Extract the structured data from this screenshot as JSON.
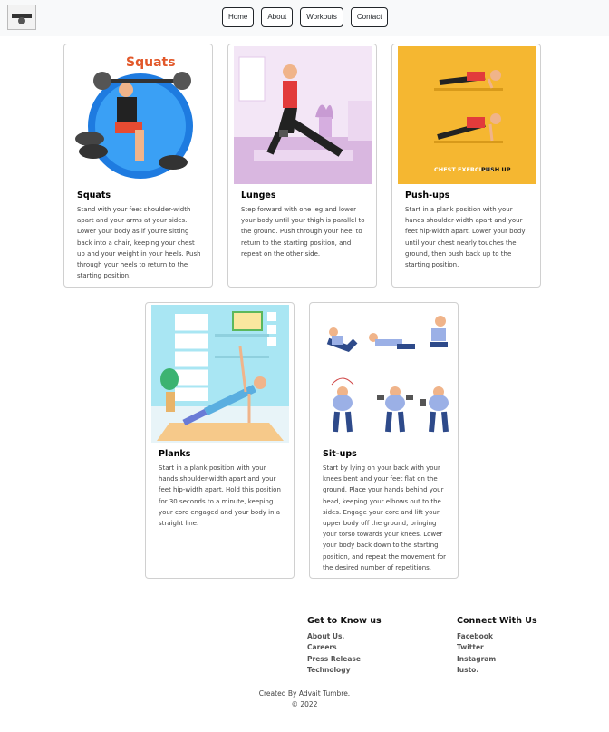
{
  "nav": {
    "logo_alt": "site logo",
    "items": [
      {
        "label": "Home"
      },
      {
        "label": "About"
      },
      {
        "label": "Workouts"
      },
      {
        "label": "Contact"
      }
    ]
  },
  "cards": [
    {
      "title": "Squats",
      "image_caption": "Squats",
      "description": "Stand with your feet shoulder-width apart and your arms at your sides. Lower your body as if you're sitting back into a chair, keeping your chest up and your weight in your heels. Push through your heels to return to the starting position."
    },
    {
      "title": "Lunges",
      "description": "Step forward with one leg and lower your body until your thigh is parallel to the ground. Push through your heel to return to the starting position, and repeat on the other side."
    },
    {
      "title": "Push-ups",
      "image_caption_a": "CHEST EXERCISES",
      "image_caption_b": "PUSH UP",
      "description": "Start in a plank position with your hands shoulder-width apart and your feet hip-width apart. Lower your body until your chest nearly touches the ground, then push back up to the starting position."
    },
    {
      "title": "Planks",
      "description": "Start in a plank position with your hands shoulder-width apart and your feet hip-width apart. Hold this position for 30 seconds to a minute, keeping your core engaged and your body in a straight line."
    },
    {
      "title": "Sit-ups",
      "description": "Start by lying on your back with your knees bent and your feet flat on the ground. Place your hands behind your head, keeping your elbows out to the sides. Engage your core and lift your upper body off the ground, bringing your torso towards your knees. Lower your body back down to the starting position, and repeat the movement for the desired number of repetitions."
    }
  ],
  "footer": {
    "col1": {
      "heading": "Get to Know us",
      "links": [
        "About Us.",
        "Careers",
        "Press Release",
        "Technology"
      ]
    },
    "col2": {
      "heading": "Connect With Us",
      "links": [
        "Facebook",
        "Twitter",
        "Instagram",
        "Iusto."
      ]
    },
    "credit": "Created By Advait Tumbre.",
    "copyright": "© 2022"
  },
  "colors": {
    "pushup_bg": "#f5b731",
    "squat_blue": "#1e7be0",
    "lunge_bg": "#f3e6f6",
    "plank_wall": "#a9e6f3"
  }
}
